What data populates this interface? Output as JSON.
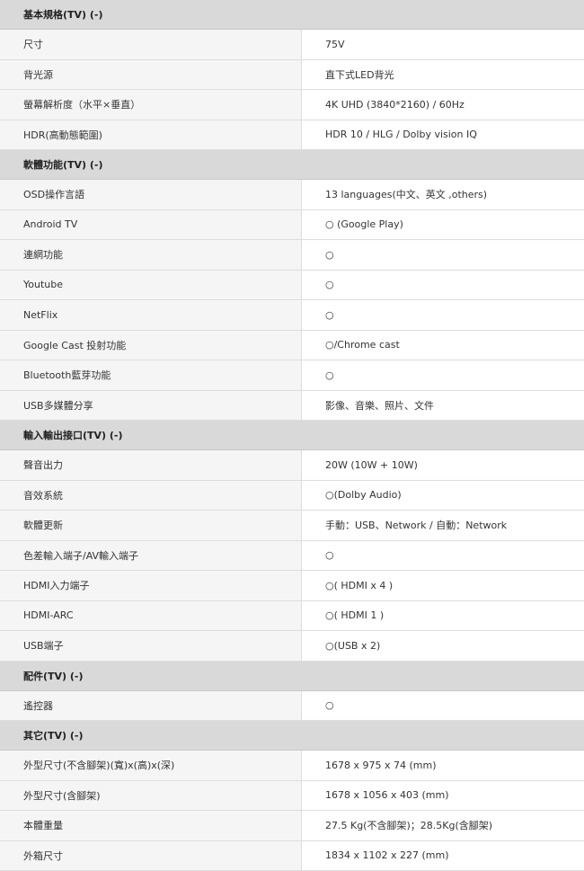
{
  "sections": [
    {
      "title": "基本規格(TV) (-)",
      "rows": [
        {
          "label": "尺寸",
          "value": "75V"
        },
        {
          "label": "背光源",
          "value": "直下式LED背光"
        },
        {
          "label": "螢幕解析度（水平×垂直）",
          "value": "4K UHD (3840*2160) / 60Hz"
        },
        {
          "label": "HDR(高動態範圍)",
          "value": "HDR 10 / HLG / Dolby vision IQ"
        }
      ]
    },
    {
      "title": "軟體功能(TV) (-)",
      "rows": [
        {
          "label": "OSD操作言語",
          "value": "13 languages(中文、英文 ,others)"
        },
        {
          "label": "Android TV",
          "value": "○ (Google Play)"
        },
        {
          "label": "連網功能",
          "value": "○"
        },
        {
          "label": "Youtube",
          "value": "○"
        },
        {
          "label": "NetFlix",
          "value": "○"
        },
        {
          "label": "Google Cast 投射功能",
          "value": "○/Chrome cast"
        },
        {
          "label": "Bluetooth藍芽功能",
          "value": "○"
        },
        {
          "label": "USB多媒體分享",
          "value": "影像、音樂、照片、文件"
        }
      ]
    },
    {
      "title": "輸入輸出接口(TV) (-)",
      "rows": [
        {
          "label": "聲音出力",
          "value": "20W (10W + 10W)"
        },
        {
          "label": "音效系統",
          "value": "○(Dolby Audio)"
        },
        {
          "label": "軟體更新",
          "value": "手動：USB、Network / 自動：Network"
        },
        {
          "label": "色差輸入端子/AV輸入端子",
          "value": "○"
        },
        {
          "label": "HDMI入力端子",
          "value": "○( HDMI x 4 )"
        },
        {
          "label": "HDMI-ARC",
          "value": "○( HDMI 1 )"
        },
        {
          "label": "USB端子",
          "value": "○(USB x 2)"
        }
      ]
    },
    {
      "title": "配件(TV) (-)",
      "rows": [
        {
          "label": "遙控器",
          "value": "○"
        }
      ]
    },
    {
      "title": "其它(TV) (-)",
      "rows": [
        {
          "label": "外型尺寸(不含腳架)(寬)x(高)x(深)",
          "value": "1678 x 975 x 74 (mm)"
        },
        {
          "label": "外型尺寸(含腳架)",
          "value": "1678 x 1056 x 403 (mm)"
        },
        {
          "label": "本體重量",
          "value": "27.5 Kg(不含腳架)；28.5Kg(含腳架)"
        },
        {
          "label": "外箱尺寸",
          "value": "1834 x 1102 x 227 (mm)"
        }
      ]
    }
  ]
}
